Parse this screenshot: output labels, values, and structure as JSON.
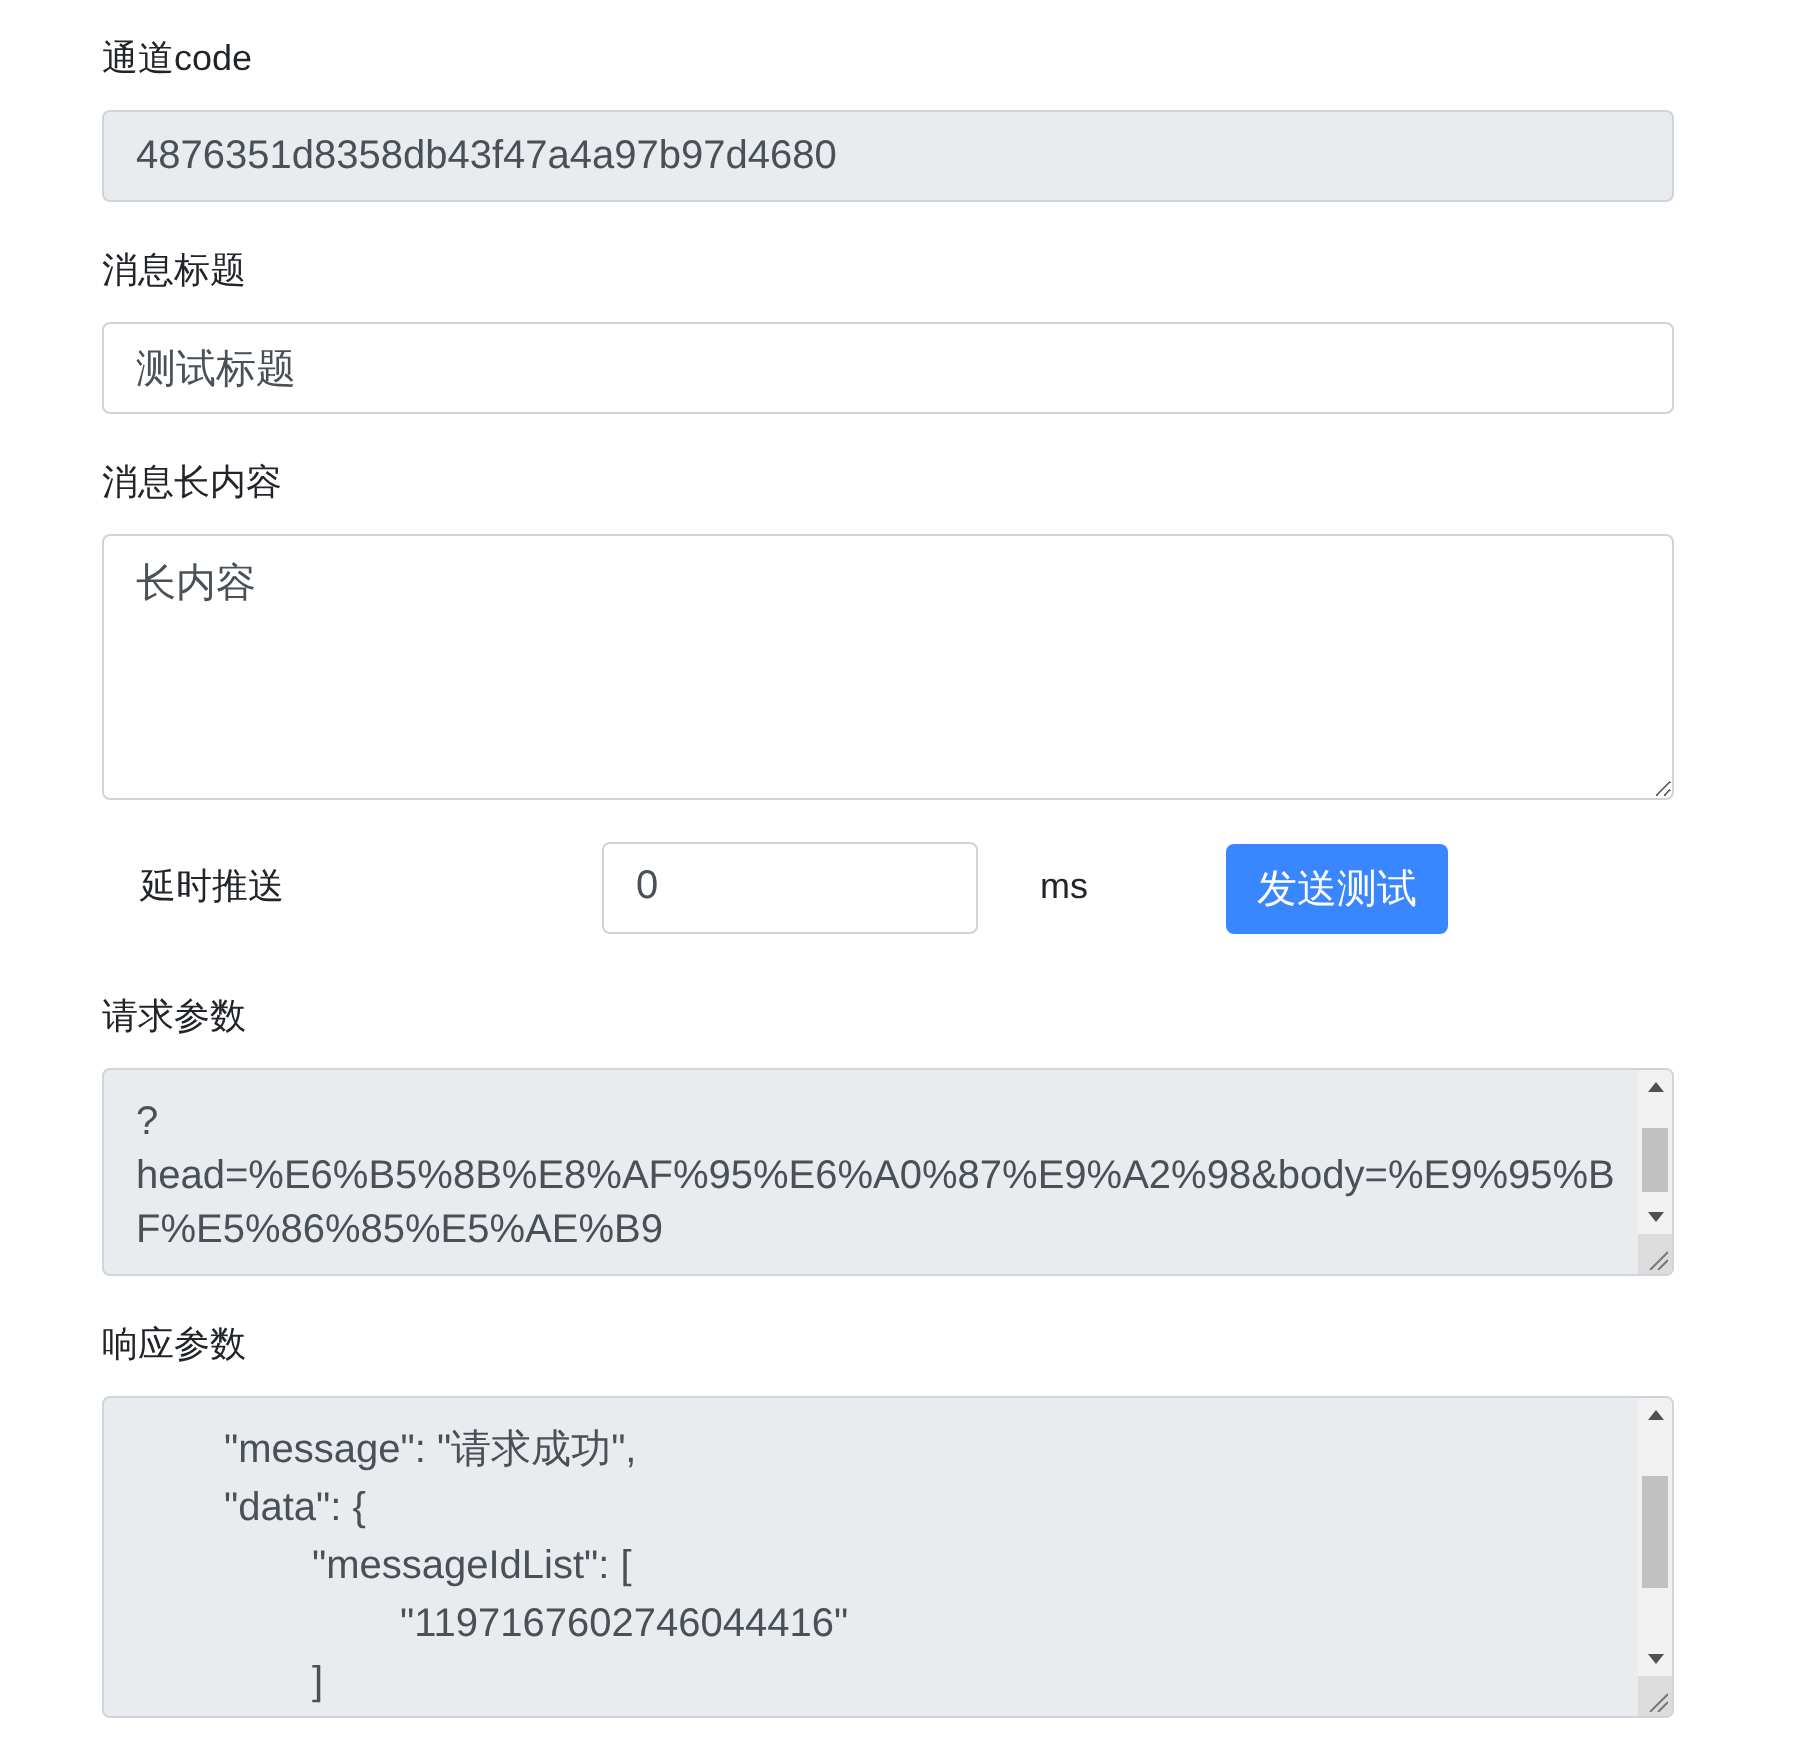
{
  "channel_code": {
    "label": "通道code",
    "value": "4876351d8358db43f47a4a97b97d4680",
    "readonly": true
  },
  "title": {
    "label": "消息标题",
    "value": "测试标题",
    "readonly": false
  },
  "long_content": {
    "label": "消息长内容",
    "value": "长内容",
    "readonly": false
  },
  "delay": {
    "label": "延时推送",
    "value": "0",
    "readonly": false,
    "unit": "ms",
    "button": "发送测试"
  },
  "request_params": {
    "label": "请求参数",
    "readonly": true,
    "lines": [
      "?",
      "head=%E6%B5%8B%E8%AF%95%E6%A0%87%E9%A2%98&body=%E9%95%B",
      "F%E5%86%85%E5%AE%B9"
    ]
  },
  "response_params": {
    "label": "响应参数",
    "readonly": true,
    "lines": [
      {
        "text": "\"message\": \"请求成功\","
      },
      {
        "text": "\"data\": {",
        "children": [
          {
            "text": "\"messageIdList\": [",
            "children": [
              {
                "text": "\"1197167602746044416\""
              }
            ]
          },
          {
            "text": "]"
          }
        ]
      }
    ]
  }
}
